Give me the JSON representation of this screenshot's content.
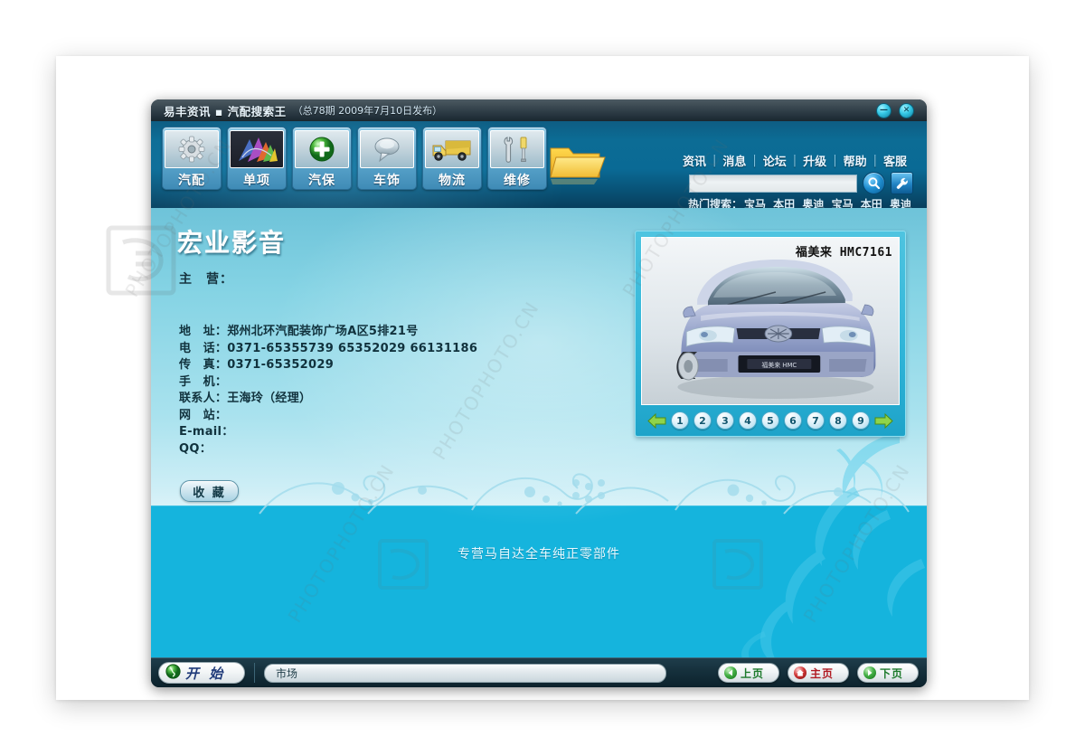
{
  "window": {
    "title": "易丰资讯 ▪ 汽配搜索王",
    "subtitle": "（总78期 2009年7月10日发布）",
    "minimize_label": "—",
    "close_label": "✕"
  },
  "toolbar": {
    "buttons": [
      {
        "label": "汽配",
        "icon": "gear-icon"
      },
      {
        "label": "单项",
        "icon": "palette-icon"
      },
      {
        "label": "汽保",
        "icon": "green-plus-sphere-icon"
      },
      {
        "label": "车饰",
        "icon": "silver-chrome-icon"
      },
      {
        "label": "物流",
        "icon": "truck-icon"
      },
      {
        "label": "维修",
        "icon": "wrench-screwdriver-icon"
      }
    ],
    "folder_icon": "open-folder-icon"
  },
  "topnav": {
    "items": [
      "资讯",
      "消息",
      "论坛",
      "升级",
      "帮助",
      "客服"
    ],
    "separator": "|"
  },
  "search": {
    "value": "",
    "placeholder": "",
    "search_icon": "magnifier-icon",
    "settings_icon": "wrench-icon",
    "hot_label": "热门搜索：",
    "hot_keywords": [
      "宝马",
      "本田",
      "奥迪",
      "宝马",
      "本田",
      "奥迪"
    ]
  },
  "shop": {
    "name": "宏业影音",
    "main_business_label": "主　营：",
    "main_business_value": "",
    "fields": [
      {
        "label": "地　址：",
        "value": "郑州北环汽配装饰广场A区5排21号"
      },
      {
        "label": "电　话：",
        "value": "0371-65355739 65352029 66131186"
      },
      {
        "label": "传　真：",
        "value": "0371-65352029"
      },
      {
        "label": "手　机：",
        "value": ""
      },
      {
        "label": "联系人：",
        "value": "王海玲（经理）"
      },
      {
        "label": "网　站：",
        "value": ""
      },
      {
        "label": "E-mail：",
        "value": ""
      },
      {
        "label": "QQ：",
        "value": ""
      }
    ],
    "favorite_button": "收 藏",
    "slogan": "专营马自达全车纯正零部件"
  },
  "photo": {
    "car_label": "福美来 HMC7161",
    "prev_arrow": "◀",
    "next_arrow": "▶",
    "pages": [
      "1",
      "2",
      "3",
      "4",
      "5",
      "6",
      "7",
      "8",
      "9"
    ]
  },
  "taskbar": {
    "start_label": "开 始",
    "start_icon": "green-globe-icon",
    "task_item": "市场",
    "nav_buttons": [
      {
        "label": "上页",
        "icon": "back-arrow-icon",
        "color": "#1d7a2c"
      },
      {
        "label": "主页",
        "icon": "home-icon",
        "color": "#b01a22"
      },
      {
        "label": "下页",
        "icon": "forward-arrow-icon",
        "color": "#1d7a2c"
      }
    ]
  },
  "watermark": {
    "text": "PHOTOPHOTO.CN"
  },
  "colors": {
    "accent_cyan": "#15b4dd",
    "header_blue": "#0a6a95",
    "title_dark": "#22313a",
    "taskbar_dark": "#16313d"
  }
}
